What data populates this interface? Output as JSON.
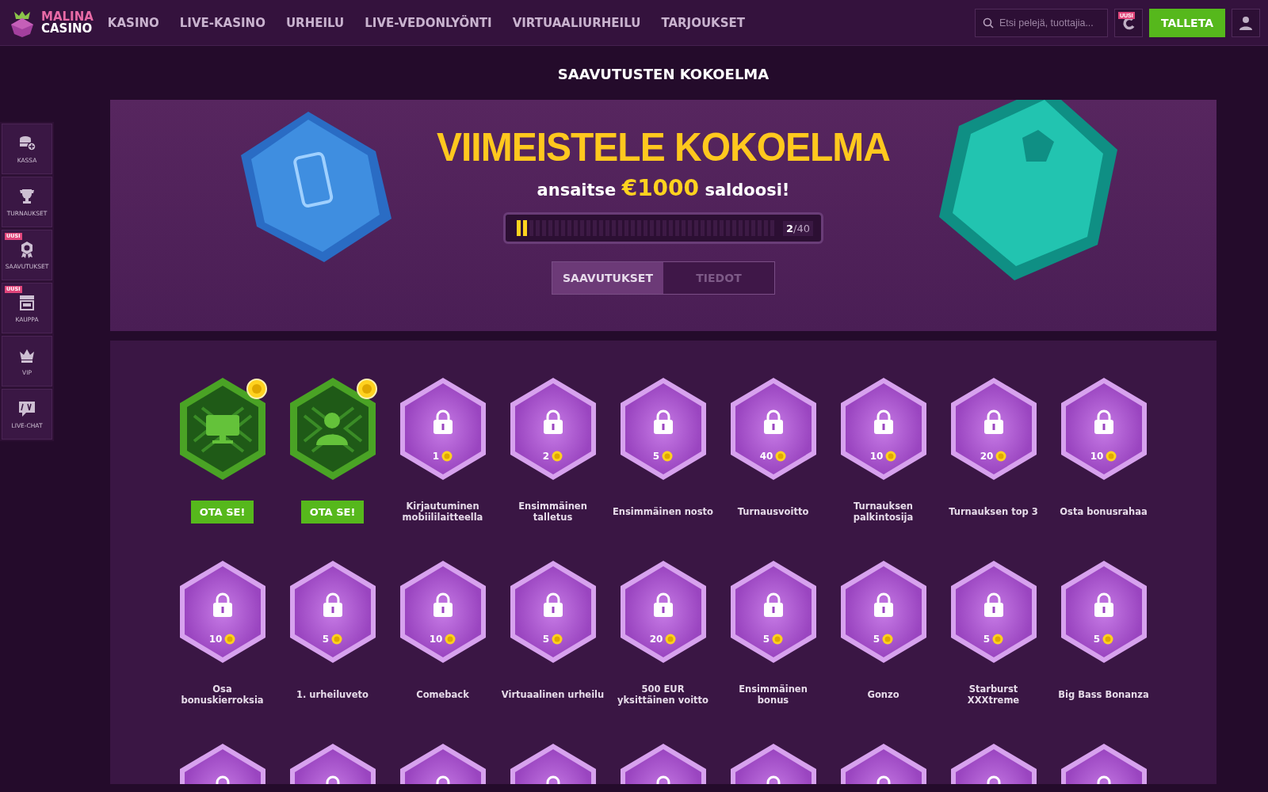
{
  "header": {
    "logo": {
      "line_1": "MALINA",
      "line_2": "CASINO"
    },
    "nav": [
      {
        "label": "KASINO"
      },
      {
        "label": "LIVE-KASINO"
      },
      {
        "label": "URHEILU"
      },
      {
        "label": "LIVE-VEDONLYÖNTI"
      },
      {
        "label": "VIRTUAALIURHEILU"
      },
      {
        "label": "TARJOUKSET"
      }
    ],
    "search": {
      "placeholder": "Etsi pelejä, tuottajia..."
    },
    "new_badge": "UUSI",
    "deposit_button": "TALLETA"
  },
  "sidebar": {
    "items": [
      {
        "label": "KASSA"
      },
      {
        "label": "TURNAUKSET"
      },
      {
        "label": "SAAVUTUKSET",
        "badge": "UUSI"
      },
      {
        "label": "KAUPPA",
        "badge": "UUSI"
      },
      {
        "label": "VIP"
      },
      {
        "label": "LIVE-CHAT"
      }
    ]
  },
  "page_title": "SAAVUTUSTEN KOKOELMA",
  "banner": {
    "headline": "VIIMEISTELE KOKOELMA",
    "subline": "ansaitse **€1000** saldoosi!",
    "progress": {
      "level": 0.05,
      "reading": "**2**/40"
    },
    "tabs": [
      {
        "label": "SAAVUTUKSET",
        "selected": true
      },
      {
        "label": "TIEDOT",
        "selected": false
      }
    ]
  },
  "achievements": [
    {
      "kind": "claimable",
      "button": "OTA SE!"
    },
    {
      "kind": "claimable",
      "button": "OTA SE!"
    },
    {
      "kind": "locked",
      "points": "1",
      "label": "Kirjautuminen mobiililaitteella"
    },
    {
      "kind": "locked",
      "points": "2",
      "label": "Ensimmäinen talletus"
    },
    {
      "kind": "locked",
      "points": "5",
      "label": "Ensimmäinen nosto"
    },
    {
      "kind": "locked",
      "points": "40",
      "label": "Turnausvoitto"
    },
    {
      "kind": "locked",
      "points": "10",
      "label": "Turnauksen palkintosija"
    },
    {
      "kind": "locked",
      "points": "20",
      "label": "Turnauksen top 3"
    },
    {
      "kind": "locked",
      "points": "10",
      "label": "Osta bonusrahaa"
    },
    {
      "kind": "locked",
      "points": "10",
      "label": "Osa bonuskierroksia"
    },
    {
      "kind": "locked",
      "points": "5",
      "label": "1. urheiluveto"
    },
    {
      "kind": "locked",
      "points": "10",
      "label": "Comeback"
    },
    {
      "kind": "locked",
      "points": "5",
      "label": "Virtuaalinen urheilu"
    },
    {
      "kind": "locked",
      "points": "20",
      "label": "500 EUR yksittäinen voitto"
    },
    {
      "kind": "locked",
      "points": "5",
      "label": "Ensimmäinen bonus"
    },
    {
      "kind": "locked",
      "points": "5",
      "label": "Gonzo"
    },
    {
      "kind": "locked",
      "points": "5",
      "label": "Starburst XXXtreme"
    },
    {
      "kind": "locked",
      "points": "5",
      "label": "Big Bass Bonanza"
    },
    {
      "kind": "locked"
    },
    {
      "kind": "locked"
    },
    {
      "kind": "locked"
    },
    {
      "kind": "locked"
    },
    {
      "kind": "locked"
    },
    {
      "kind": "locked"
    },
    {
      "kind": "locked"
    },
    {
      "kind": "locked"
    },
    {
      "kind": "locked"
    }
  ]
}
